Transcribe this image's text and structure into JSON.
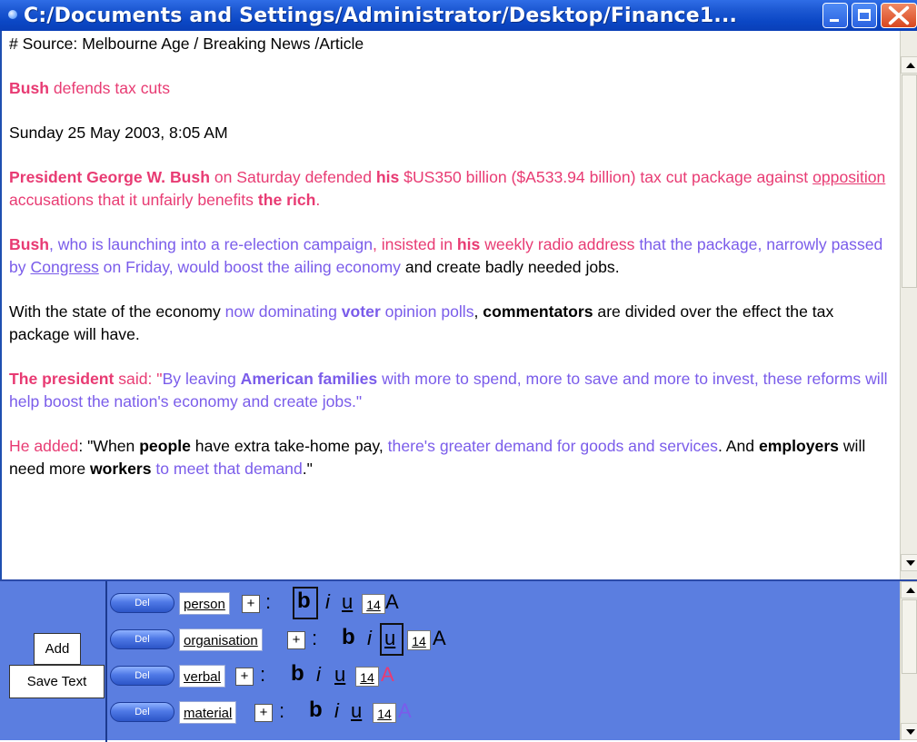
{
  "window": {
    "title": "C:/Documents and Settings/Administrator/Desktop/Finance1..."
  },
  "article": {
    "source": "# Source: Melbourne Age / Breaking News /Article",
    "headline": {
      "bold": "Bush",
      "rest": " defends tax cuts"
    },
    "dateline": "Sunday 25 May 2003, 8:05 AM",
    "p1": {
      "t1": "President George W. Bush",
      "t2": " on Saturday defended ",
      "t3": "his",
      "t4": " $US350 billion ($A533.94 billion) tax cut package against ",
      "t5": "opposition",
      "t6": " accusations that it unfairly benefits ",
      "t7": "the rich",
      "t8": "."
    },
    "p2": {
      "t1": "Bush",
      "t2": ", who is launching into a re-election campaign",
      "t3": ", insisted in ",
      "t4": "his",
      "t5": " weekly radio address",
      "t6": " that the package, narrowly passed by ",
      "t7": "Congress",
      "t8": " on Friday, would boost the ailing economy",
      "t9": " and create badly needed jobs."
    },
    "p3": {
      "t1": "With the state of the economy ",
      "t2": "now dominating ",
      "t3": "voter",
      "t4": " opinion polls",
      "t5": ", ",
      "t6": "commentators",
      "t7": " are divided over the effect the tax package will have."
    },
    "p4": {
      "t1": "The president",
      "t2": " said",
      "t3": ": \"",
      "t4": "By leaving ",
      "t5": "American families",
      "t6": " with more to spend, more to save and more to invest",
      "t7": ", these reforms will help boost the nation's economy and create jobs.\""
    },
    "p5": {
      "t1": "He added",
      "t2": ": \"When ",
      "t3": "people",
      "t4": " have extra take-home pay, ",
      "t5": "there's greater demand for goods and services",
      "t6": ". And ",
      "t7": "employers",
      "t8": " will need more ",
      "t9": "workers",
      "t10": " to meet that demand",
      "t11": ".\""
    }
  },
  "panel": {
    "add_label": "Add",
    "save_label": "Save Text",
    "del_label": "Del",
    "plus_label": "+",
    "colon": ":",
    "bold_label": "b",
    "italic_label": "i",
    "underline_label": "u",
    "color_label": "A",
    "tags": [
      {
        "name": "person",
        "size": "14",
        "color": "#000000"
      },
      {
        "name": "organisation",
        "size": "14",
        "color": "#000000"
      },
      {
        "name": "verbal",
        "size": "14",
        "color": "#e83b73"
      },
      {
        "name": "material",
        "size": "14",
        "color": "#7a5cea"
      }
    ]
  },
  "colors": {
    "titlebar": "#0b47c5",
    "panel": "#5b7ee0",
    "pink": "#e83b73",
    "purple": "#7a5cea"
  },
  "icons": [
    "app-icon",
    "minimize-icon",
    "maximize-icon",
    "close-icon",
    "scroll-up-icon",
    "scroll-down-icon"
  ]
}
